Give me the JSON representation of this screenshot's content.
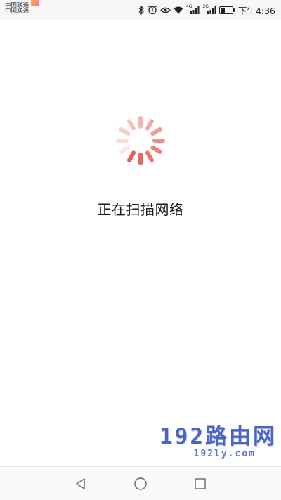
{
  "status_bar": {
    "carrier_1": "中国联通",
    "carrier_2": "中国联通",
    "net_1": "4G",
    "net_2": "2G",
    "time": "下午4:36",
    "battery_level": 0.35,
    "icons": [
      "bluetooth-icon",
      "alarm-icon",
      "eye-comfort-icon",
      "wifi-icon",
      "signal-icon",
      "signal-icon",
      "battery-icon"
    ]
  },
  "main": {
    "status_text": "正在扫描网络",
    "spinner_color": "#e5534b"
  },
  "watermark": {
    "title": "192路由网",
    "url": "192ly.com",
    "color": "#4a63c8"
  },
  "nav_bar": {
    "buttons": [
      "back-icon",
      "home-icon",
      "recent-apps-icon"
    ]
  }
}
